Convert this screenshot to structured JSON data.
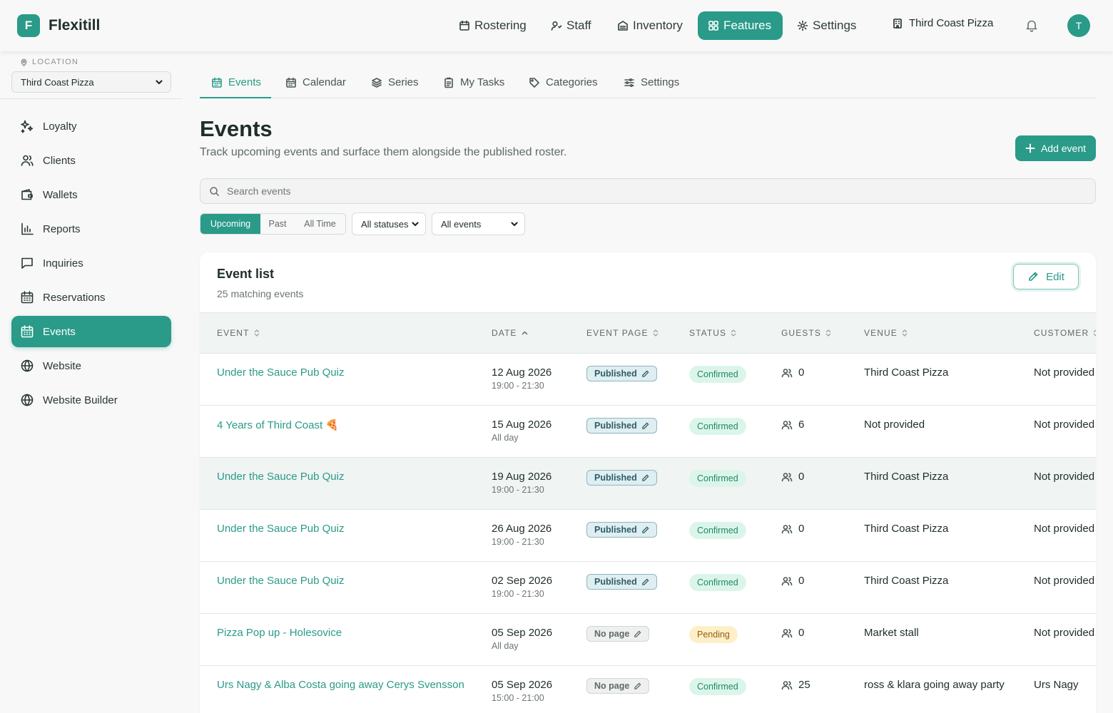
{
  "app": {
    "logo_letter": "F",
    "name": "Flexitill"
  },
  "topnav": [
    {
      "label": "Rostering",
      "icon": "calendar-icon"
    },
    {
      "label": "Staff",
      "icon": "user-icon"
    },
    {
      "label": "Inventory",
      "icon": "archive-icon"
    },
    {
      "label": "Features",
      "icon": "grid-icon",
      "active": true
    },
    {
      "label": "Settings",
      "icon": "gear-icon"
    }
  ],
  "location_button": "Third Coast Pizza",
  "user_initial": "T",
  "sidebar": {
    "location_label": "LOCATION",
    "location_value": "Third Coast Pizza",
    "items": [
      {
        "label": "Loyalty",
        "icon": "sparkle-icon"
      },
      {
        "label": "Clients",
        "icon": "users-icon"
      },
      {
        "label": "Wallets",
        "icon": "wallet-icon"
      },
      {
        "label": "Reports",
        "icon": "bar-chart-icon"
      },
      {
        "label": "Inquiries",
        "icon": "message-icon"
      },
      {
        "label": "Reservations",
        "icon": "calendar-icon"
      },
      {
        "label": "Events",
        "icon": "calendar-icon",
        "active": true
      },
      {
        "label": "Website",
        "icon": "globe-icon"
      },
      {
        "label": "Website Builder",
        "icon": "globe-icon"
      }
    ]
  },
  "tabs": [
    {
      "label": "Events",
      "active": true
    },
    {
      "label": "Calendar"
    },
    {
      "label": "Series"
    },
    {
      "label": "My Tasks"
    },
    {
      "label": "Categories"
    },
    {
      "label": "Settings"
    }
  ],
  "page": {
    "title": "Events",
    "subtitle": "Track upcoming events and surface them alongside the published roster.",
    "add_button": "Add event",
    "search_placeholder": "Search events"
  },
  "filters": {
    "time_ranges": [
      "Upcoming",
      "Past",
      "All Time"
    ],
    "time_selected": "Upcoming",
    "status_select": "All statuses",
    "type_select": "All events"
  },
  "list": {
    "title": "Event list",
    "count_text": "25 matching events",
    "edit_button": "Edit",
    "columns": [
      "EVENT",
      "DATE",
      "EVENT PAGE",
      "STATUS",
      "GUESTS",
      "VENUE",
      "CUSTOMER"
    ],
    "rows": [
      {
        "event": "Under the Sauce Pub Quiz",
        "date": "12 Aug 2026",
        "time": "19:00 - 21:30",
        "page": "Published",
        "status": "Confirmed",
        "guests": "0",
        "venue": "Third Coast Pizza",
        "customer": "Not provided"
      },
      {
        "event": "4 Years of Third Coast 🍕",
        "date": "15 Aug 2026",
        "time": "All day",
        "page": "Published",
        "status": "Confirmed",
        "guests": "6",
        "venue": "Not provided",
        "customer": "Not provided"
      },
      {
        "event": "Under the Sauce Pub Quiz",
        "date": "19 Aug 2026",
        "time": "19:00 - 21:30",
        "page": "Published",
        "status": "Confirmed",
        "guests": "0",
        "venue": "Third Coast Pizza",
        "customer": "Not provided"
      },
      {
        "event": "Under the Sauce Pub Quiz",
        "date": "26 Aug 2026",
        "time": "19:00 - 21:30",
        "page": "Published",
        "status": "Confirmed",
        "guests": "0",
        "venue": "Third Coast Pizza",
        "customer": "Not provided"
      },
      {
        "event": "Under the Sauce Pub Quiz",
        "date": "02 Sep 2026",
        "time": "19:00 - 21:30",
        "page": "Published",
        "status": "Confirmed",
        "guests": "0",
        "venue": "Third Coast Pizza",
        "customer": "Not provided"
      },
      {
        "event": "Pizza Pop up - Holesovice",
        "date": "05 Sep 2026",
        "time": "All day",
        "page": "No page",
        "status": "Pending",
        "guests": "0",
        "venue": "Market stall",
        "customer": "Not provided"
      },
      {
        "event": "Urs Nagy & Alba Costa going away Cerys Svensson",
        "date": "05 Sep 2026",
        "time": "15:00 - 21:00",
        "page": "No page",
        "status": "Confirmed",
        "guests": "25",
        "venue": "ross & klara going away party",
        "customer": "Urs Nagy"
      }
    ]
  },
  "colors": {
    "accent": "#2a9a89",
    "confirmed_bg": "#dcf5ea",
    "pending_bg": "#fdf0c8"
  }
}
